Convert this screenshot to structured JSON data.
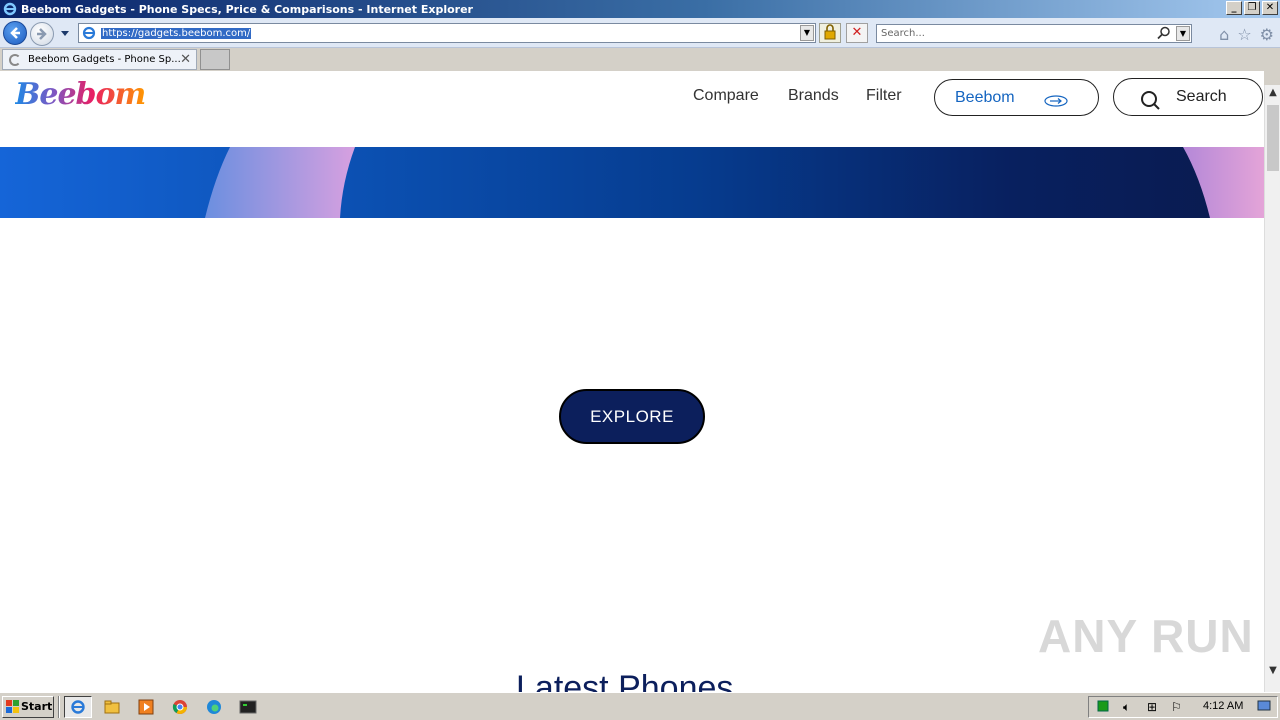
{
  "window": {
    "title": "Beebom Gadgets - Phone Specs, Price & Comparisons - Internet Explorer"
  },
  "addressbar": {
    "url": "https://gadgets.beebom.com/",
    "search_placeholder": "Search..."
  },
  "tabs": [
    {
      "label": "Beebom Gadgets - Phone Sp...",
      "loading": true
    }
  ],
  "site": {
    "logo_text": "Beebom",
    "nav": {
      "compare": "Compare",
      "brands": "Brands",
      "filter": "Filter",
      "beebom_link": "Beebom",
      "search": "Search"
    },
    "explore_label": "EXPLORE",
    "section_heading": "Latest Phones"
  },
  "watermark": "ANY RUN",
  "taskbar": {
    "start_label": "Start",
    "clock": "4:12 AM"
  },
  "colors": {
    "accent_blue": "#1565c0",
    "navy": "#0c1f5c",
    "title_bar": "#0a246a"
  }
}
